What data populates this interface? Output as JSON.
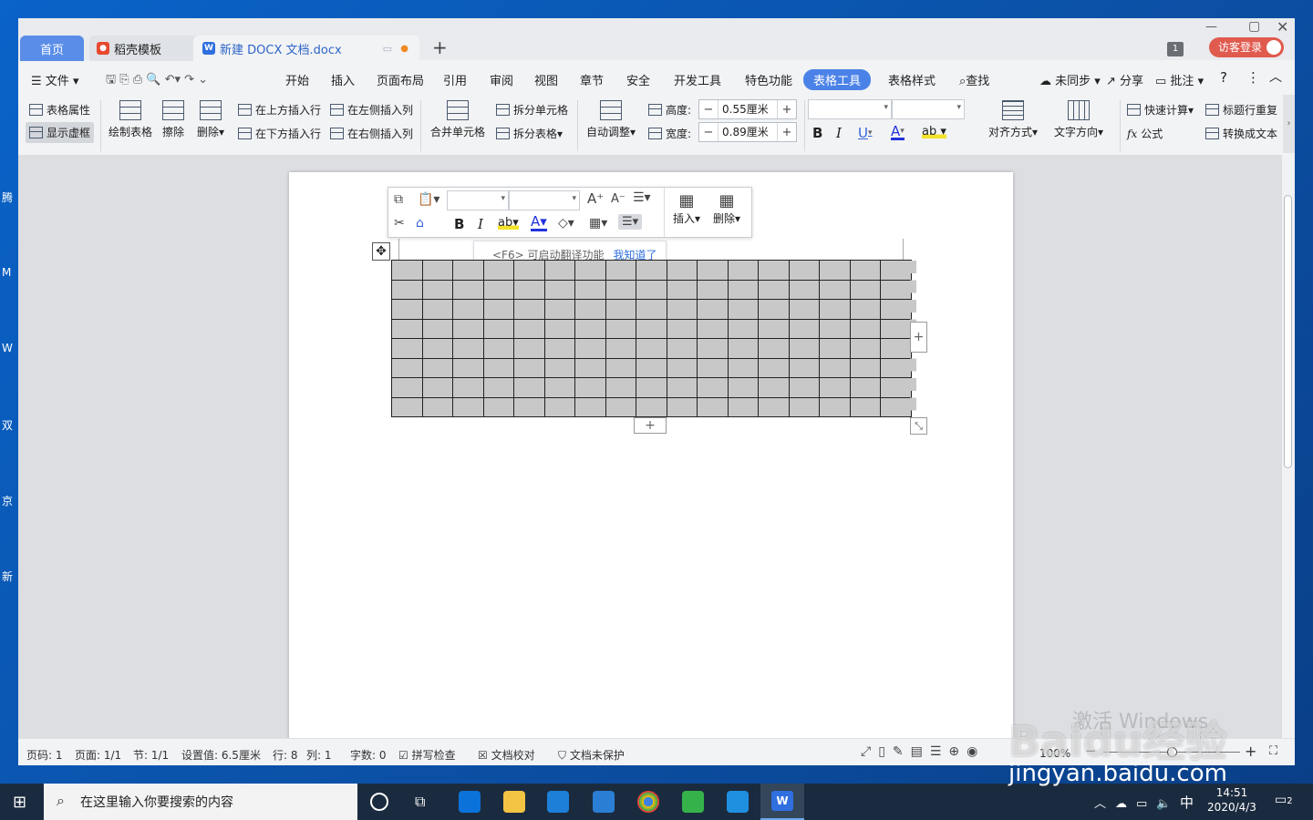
{
  "desktop": {
    "icon_labels": [
      "腾",
      "M",
      "W",
      "双",
      "京",
      "新"
    ]
  },
  "titlebar": {
    "page_num": "1",
    "login_label": "访客登录"
  },
  "tabs": {
    "home": "首页",
    "docer": "稻壳模板",
    "doc": "新建 DOCX 文档.docx",
    "new_tab": "+"
  },
  "menu": {
    "file": "文件",
    "items": [
      "开始",
      "插入",
      "页面布局",
      "引用",
      "审阅",
      "视图",
      "章节",
      "安全",
      "开发工具",
      "特色功能",
      "表格工具",
      "表格样式"
    ],
    "search": "查找",
    "sync": "未同步",
    "share": "分享",
    "comment": "批注",
    "help": "?",
    "more": "⋮"
  },
  "ribbon": {
    "table_props": "表格属性",
    "show_grid": "显示虚框",
    "draw_table": "绘制表格",
    "eraser": "擦除",
    "delete": "删除",
    "insert_above": "在上方插入行",
    "insert_below": "在下方插入行",
    "insert_left": "在左侧插入列",
    "insert_right": "在右侧插入列",
    "merge_cells": "合并单元格",
    "split_cells": "拆分单元格",
    "split_table": "拆分表格",
    "auto_fit": "自动调整",
    "height_label": "高度:",
    "height_value": "0.55厘米",
    "width_label": "宽度:",
    "width_value": "0.89厘米",
    "bold": "B",
    "italic": "I",
    "underline": "U",
    "font_color": "A",
    "align": "对齐方式",
    "text_dir": "文字方向",
    "quick_calc": "快速计算",
    "formula": "公式",
    "repeat_header": "标题行重复",
    "to_text": "转换成文本"
  },
  "floatbar": {
    "insert": "插入",
    "delete": "删除",
    "bold": "B",
    "italic": "I"
  },
  "tip": {
    "text": "<F6> 可启动翻译功能",
    "link": "我知道了"
  },
  "table": {
    "rows": 8,
    "cols": 17
  },
  "status": {
    "page": "页码: 1",
    "pages": "页面: 1/1",
    "section": "节: 1/1",
    "setting": "设置值: 6.5厘米",
    "row": "行: 8",
    "col": "列: 1",
    "words": "字数: 0",
    "spell": "拼写检查",
    "proof": "文档校对",
    "protect": "文档未保护",
    "zoom": "100%"
  },
  "taskbar": {
    "search_placeholder": "在这里输入你要搜索的内容",
    "ime": "中",
    "time": "14:51",
    "date": "2020/4/3",
    "notif": "2"
  },
  "watermark": {
    "activate": "激活 Windows",
    "brand": "Baidu经验",
    "url": "jingyan.baidu.com"
  }
}
